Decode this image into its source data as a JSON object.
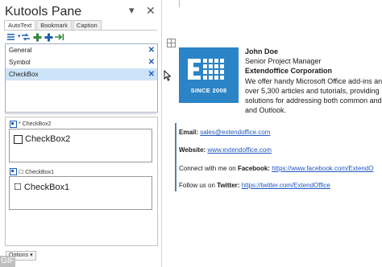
{
  "pane": {
    "title": "Kutools Pane",
    "dropdown_glyph": "▾",
    "close_glyph": "✕",
    "tabs": [
      {
        "label": "AutoText",
        "active": true
      },
      {
        "label": "Bookmark",
        "active": false
      },
      {
        "label": "Caption",
        "active": false
      }
    ],
    "toolbar_icons": [
      "list-menu-icon",
      "back-forward-icon",
      "add-icon",
      "plus-icon",
      "insert-icon"
    ],
    "categories": [
      {
        "label": "General",
        "selected": false
      },
      {
        "label": "Symbol",
        "selected": false
      },
      {
        "label": "CheckBox",
        "selected": true
      }
    ],
    "delete_glyph": "✕",
    "entries": [
      {
        "header": "* CheckBox2",
        "text": "CheckBox2"
      },
      {
        "header": "☐ CheckBox1",
        "text": "☐ CheckBox1"
      }
    ],
    "options_label": "Options ▾"
  },
  "watermark": "GIF",
  "document": {
    "logo_text": "SINCE 2008",
    "name": "John Doe",
    "job_title": "Senior Project Manager",
    "company": "Extendoffice Corporation",
    "desc1": "We offer handy Microsoft Office add-ins and",
    "desc2": "over 5,300 articles and tutorials, providing",
    "desc3": "solutions for addressing both common and",
    "desc4": "and Outlook.",
    "email_label": "Email:",
    "email": "sales@extendoffice.com",
    "website_label": "Website:",
    "website": "www.extendoffice.com",
    "facebook_prefix": "Connect with me on",
    "facebook_label": "Facebook:",
    "facebook": "https://www.facebook.com/ExtendO",
    "twitter_prefix": "Follow us on",
    "twitter_label": "Twitter:",
    "twitter": "https://twitter.com/ExtendOffice"
  },
  "colors": {
    "logo_bg": "#2a84c6",
    "link": "#1f56c0",
    "selection": "#cce3f8",
    "accent_bar": "#5b7fb0"
  }
}
